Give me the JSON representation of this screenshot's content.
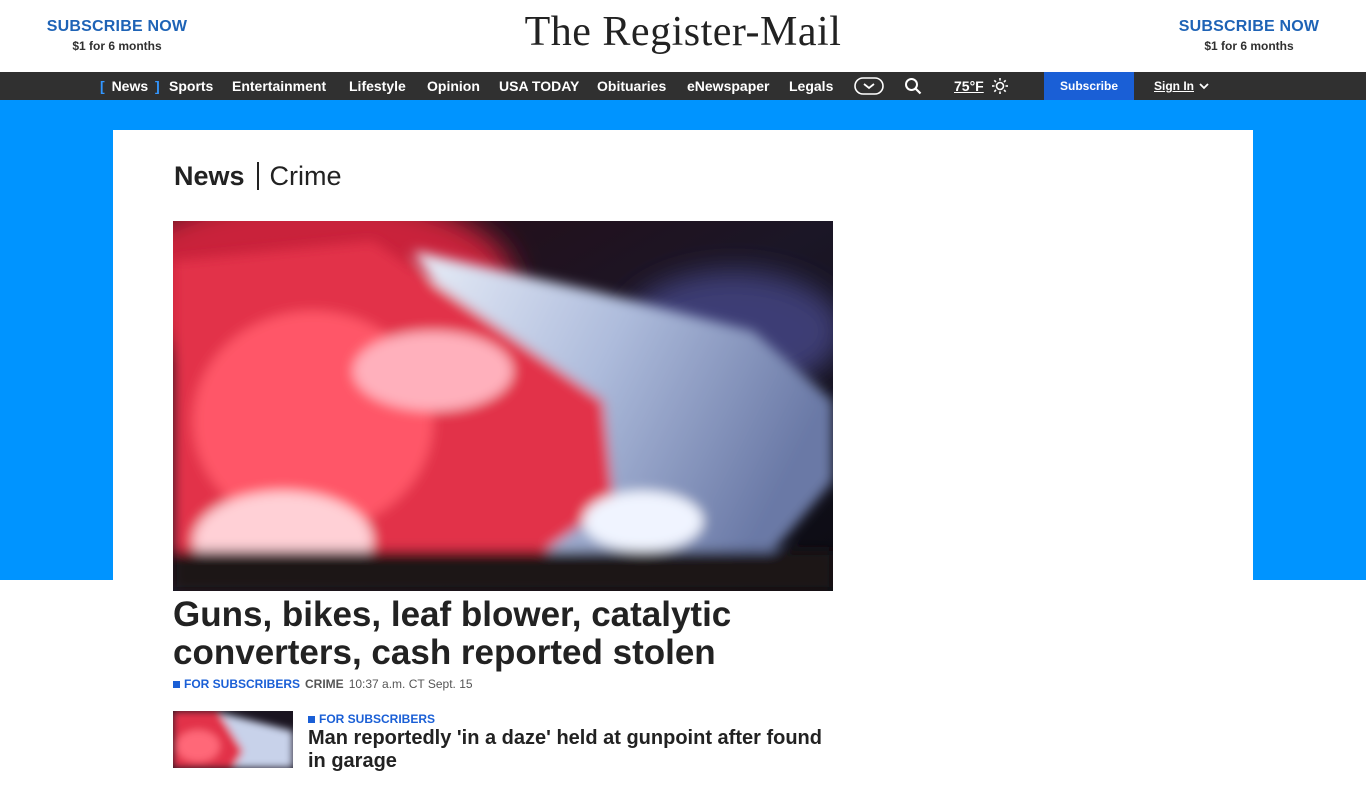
{
  "masthead": {
    "brand": "The Register-Mail",
    "promo_left": {
      "title": "SUBSCRIBE NOW",
      "subtitle": "$1 for 6 months"
    },
    "promo_right": {
      "title": "SUBSCRIBE NOW",
      "subtitle": "$1 for 6 months"
    }
  },
  "nav": {
    "active_open": "[",
    "active_close": "]",
    "items": [
      "News",
      "Sports",
      "Entertainment",
      "Lifestyle",
      "Opinion",
      "USA TODAY",
      "Obituaries",
      "eNewspaper",
      "Legals"
    ],
    "more_icon": "chevron-down-circle-icon",
    "search_icon": "search-icon",
    "weather": {
      "temp": "75°F",
      "icon": "sun-icon"
    },
    "subscribe": "Subscribe",
    "sign_in": "Sign In"
  },
  "colors": {
    "brand_blue": "#1e63b6",
    "nav_bg": "#303030",
    "band_blue": "#0094ff",
    "accent_blue": "#1a5fd6"
  },
  "section": {
    "name": "News",
    "sub": "Crime"
  },
  "lead_story": {
    "headline": "Guns, bikes, leaf blower, catalytic converters, cash reported stolen",
    "label": "FOR SUBSCRIBERS",
    "category": "CRIME",
    "time": "10:37 a.m. CT Sept. 15"
  },
  "story2": {
    "label": "FOR SUBSCRIBERS",
    "headline": "Man reportedly 'in a daze' held at gunpoint after found in garage"
  }
}
